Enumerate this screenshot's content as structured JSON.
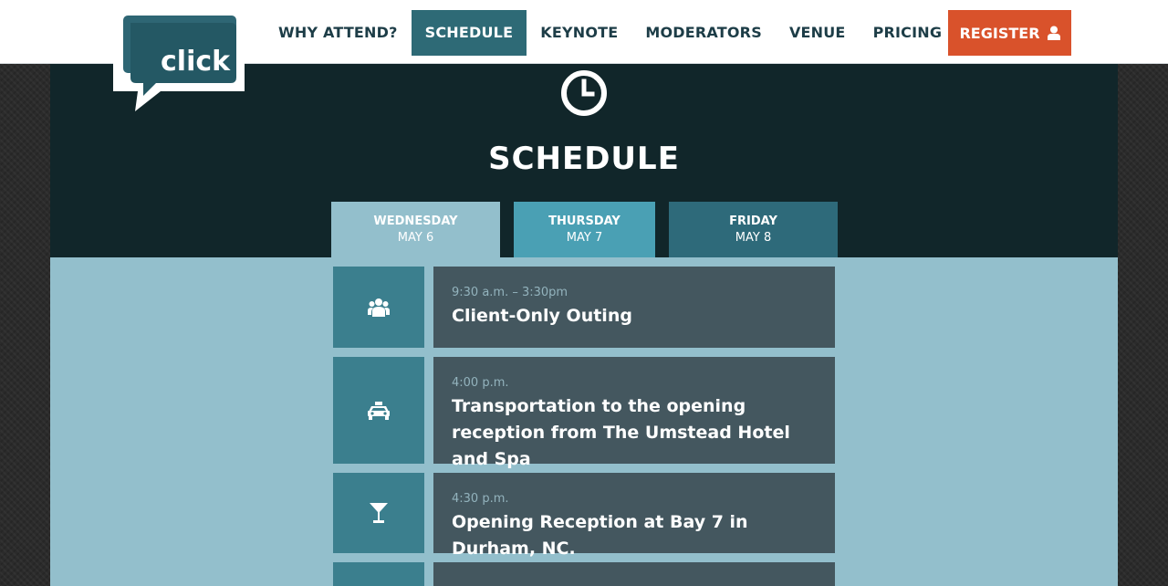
{
  "brand": {
    "logo_text": "click"
  },
  "nav": {
    "items": [
      {
        "label": "WHY ATTEND?",
        "active": false
      },
      {
        "label": "SCHEDULE",
        "active": true
      },
      {
        "label": "KEYNOTE",
        "active": false
      },
      {
        "label": "MODERATORS",
        "active": false
      },
      {
        "label": "VENUE",
        "active": false
      },
      {
        "label": "PRICING",
        "active": false
      }
    ],
    "register_label": "REGISTER",
    "register_icon": "user-icon"
  },
  "hero": {
    "icon": "clock-icon",
    "title": "SCHEDULE"
  },
  "tabs": [
    {
      "day": "WEDNESDAY",
      "date": "MAY 6",
      "selected": true
    },
    {
      "day": "THURSDAY",
      "date": "MAY 7",
      "selected": false
    },
    {
      "day": "FRIDAY",
      "date": "MAY 8",
      "selected": false
    }
  ],
  "events": [
    {
      "icon": "group-icon",
      "time": "9:30 a.m. – 3:30pm",
      "title": "Client-Only Outing"
    },
    {
      "icon": "taxi-icon",
      "time": "4:00 p.m.",
      "title": "Transportation to the opening reception from The Umstead Hotel and Spa"
    },
    {
      "icon": "cocktail-icon",
      "time": "4:30 p.m.",
      "title": "Opening Reception at Bay 7 in Durham, NC."
    }
  ],
  "colors": {
    "nav_text": "#1d3d47",
    "nav_active_bg": "#2e6a76",
    "register_bg": "#d9522b",
    "hero_bg": "#11262a",
    "content_bg": "#93bfcc",
    "event_icon_bg": "#3b7f8e",
    "event_card_bg": "#44575f"
  }
}
